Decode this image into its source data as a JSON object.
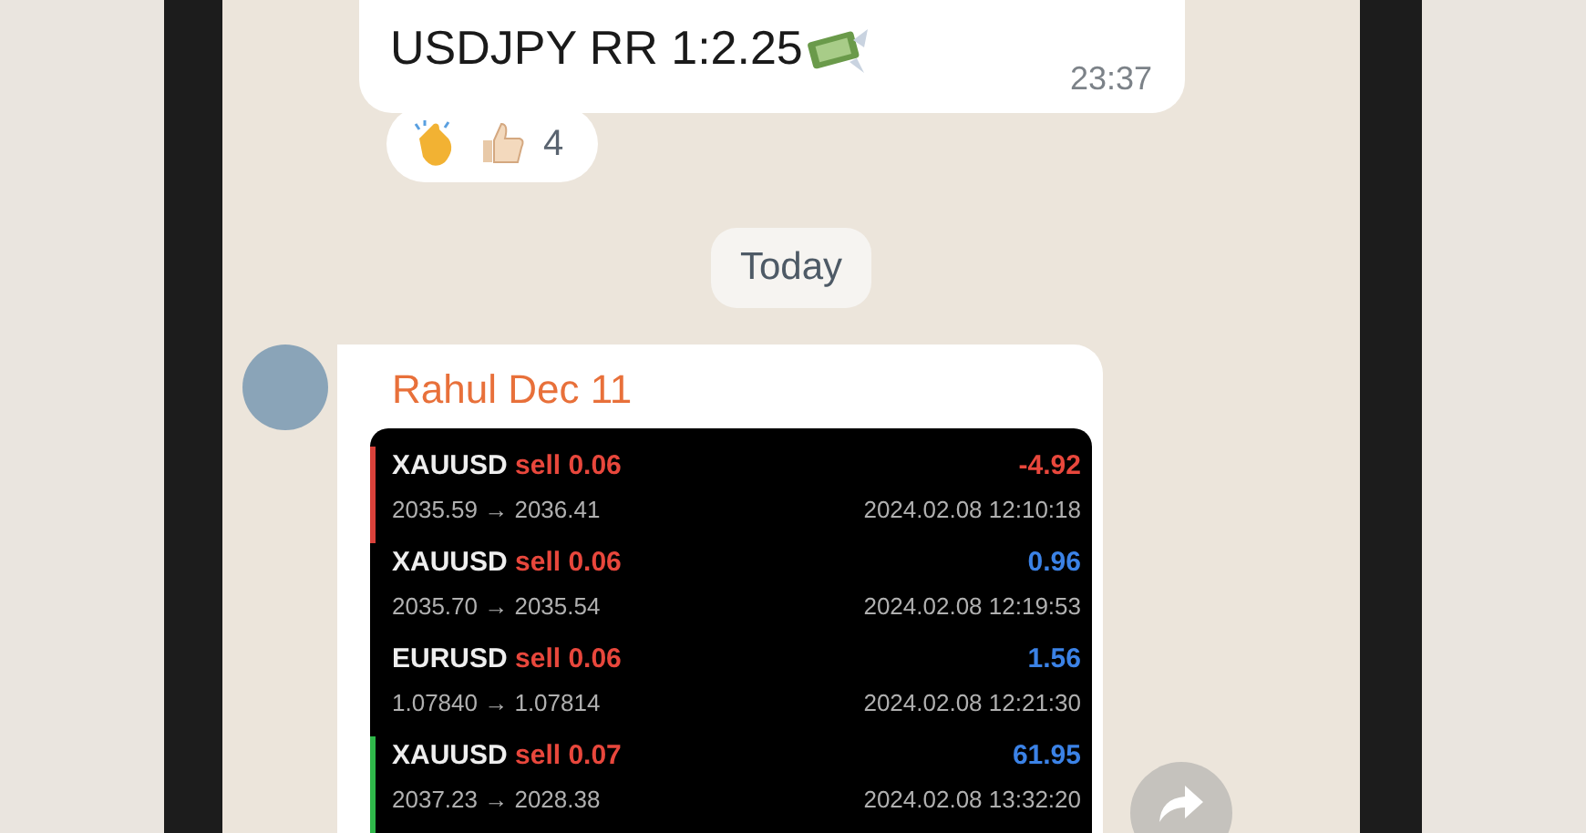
{
  "messages": [
    {
      "kind": "text",
      "text": "USDJPY RR 1:2.25",
      "time": "23:37",
      "reactions": {
        "count": "4"
      }
    },
    {
      "kind": "date",
      "text": "Today"
    },
    {
      "kind": "image",
      "sender": "Rahul Dec 11",
      "trades": [
        {
          "symbol": "XAUUSD",
          "side": "sell 0.06",
          "prices": "2035.59 → 2036.41",
          "profit": "-4.92",
          "color": "#e8473c",
          "edge": {
            "color": "#d9413a"
          },
          "datetime": "2024.02.08 12:10:18"
        },
        {
          "symbol": "XAUUSD",
          "side": "sell 0.06",
          "prices": "2035.70 → 2035.54",
          "profit": "0.96",
          "color": "#3b82e6",
          "datetime": "2024.02.08 12:19:53"
        },
        {
          "symbol": "EURUSD",
          "side": "sell 0.06",
          "prices": "1.07840 → 1.07814",
          "profit": "1.56",
          "color": "#3b82e6",
          "datetime": "2024.02.08 12:21:30"
        },
        {
          "symbol": "XAUUSD",
          "side": "sell 0.07",
          "prices": "2037.23 → 2028.38",
          "profit": "61.95",
          "color": "#3b82e6",
          "edge": {
            "color": "#2fb84a"
          },
          "datetime": "2024.02.08 13:32:20"
        }
      ]
    }
  ]
}
